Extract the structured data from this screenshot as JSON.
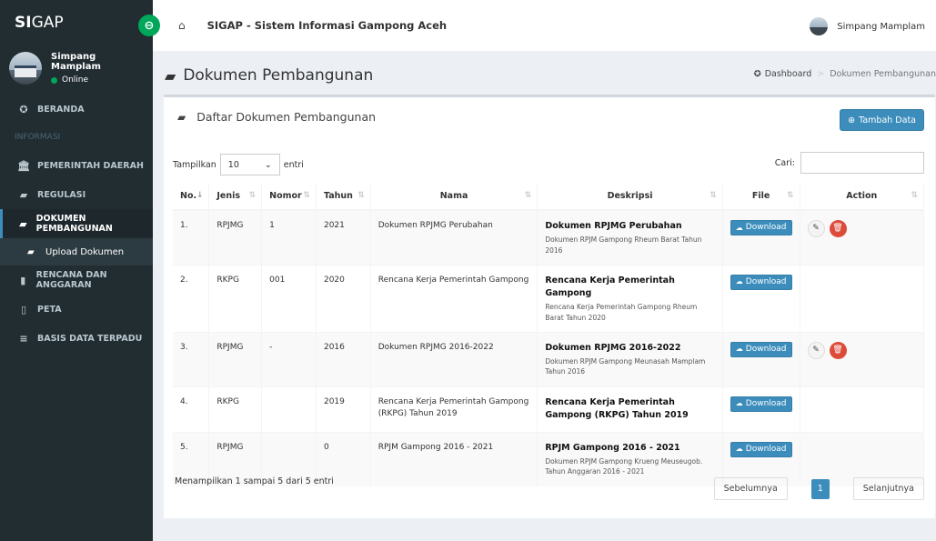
{
  "brand": {
    "bold": "SI",
    "rest": "GAP"
  },
  "user": {
    "name": "Simpang Mamplam",
    "status": "Online"
  },
  "menu": {
    "beranda": "BERANDA",
    "header_informasi": "INFORMASI",
    "pemerintah": "PEMERINTAH DAERAH",
    "regulasi": "REGULASI",
    "dokumen": "DOKUMEN PEMBANGUNAN",
    "upload": "Upload Dokumen",
    "rencana": "RENCANA DAN ANGGARAN",
    "peta": "PETA",
    "basis": "BASIS DATA TERPADU"
  },
  "topbar": {
    "title": "SIGAP - Sistem Informasi Gampong Aceh",
    "user": "Simpang Mamplam"
  },
  "page": {
    "title": "Dokumen Pembangunan",
    "breadcrumb_home": "Dashboard",
    "breadcrumb_current": "Dokumen Pembangunan"
  },
  "box": {
    "title": "Daftar Dokumen Pembangunan",
    "add_label": "Tambah Data"
  },
  "controls": {
    "show_label": "Tampilkan",
    "length_value": "10",
    "entries_label": "entri",
    "search_label": "Cari:"
  },
  "table": {
    "headers": {
      "no": "No.",
      "jenis": "Jenis",
      "nomor": "Nomor",
      "tahun": "Tahun",
      "nama": "Nama",
      "deskripsi": "Deskripsi",
      "file": "File",
      "action": "Action"
    },
    "download_label": "Download",
    "rows": [
      {
        "no": "1.",
        "jenis": "RPJMG",
        "nomor": "1",
        "tahun": "2021",
        "nama": "Dokumen RPJMG Perubahan",
        "desc_title": "Dokumen RPJMG Perubahan",
        "desc_sub": "Dokumen RPJM Gampong Rheum Barat Tahun 2016"
      },
      {
        "no": "2.",
        "jenis": "RKPG",
        "nomor": "001",
        "tahun": "2020",
        "nama": "Rencana Kerja Pemerintah Gampong",
        "desc_title": "Rencana Kerja Pemerintah Gampong",
        "desc_sub": "Rencana Kerja Pemerintah Gampong Rheum Barat Tahun 2020"
      },
      {
        "no": "3.",
        "jenis": "RPJMG",
        "nomor": "-",
        "tahun": "2016",
        "nama": "Dokumen RPJMG 2016-2022",
        "desc_title": "Dokumen RPJMG 2016-2022",
        "desc_sub": "Dokumen RPJM Gampong Meunasah Mamplam Tahun 2016"
      },
      {
        "no": "4.",
        "jenis": "RKPG",
        "nomor": "",
        "tahun": "2019",
        "nama": "Rencana Kerja Pemerintah Gampong (RKPG) Tahun 2019",
        "desc_title": "Rencana Kerja Pemerintah Gampong (RKPG) Tahun 2019",
        "desc_sub": ""
      },
      {
        "no": "5.",
        "jenis": "RPJMG",
        "nomor": "",
        "tahun": "0",
        "nama": "RPJM Gampong 2016 - 2021",
        "desc_title": "RPJM Gampong 2016 - 2021",
        "desc_sub": "Dokumen RPJM Gampong Krueng Meuseugob. Tahun Anggaran 2016 - 2021"
      }
    ]
  },
  "footer": {
    "info": "Menampilkan 1 sampai 5 dari 5 entri",
    "prev": "Sebelumnya",
    "page": "1",
    "next": "Selanjutnya"
  },
  "colors": {
    "primary": "#3c8dbc",
    "danger": "#dd4b39",
    "success": "#00a65a",
    "sidebar": "#222d32"
  }
}
